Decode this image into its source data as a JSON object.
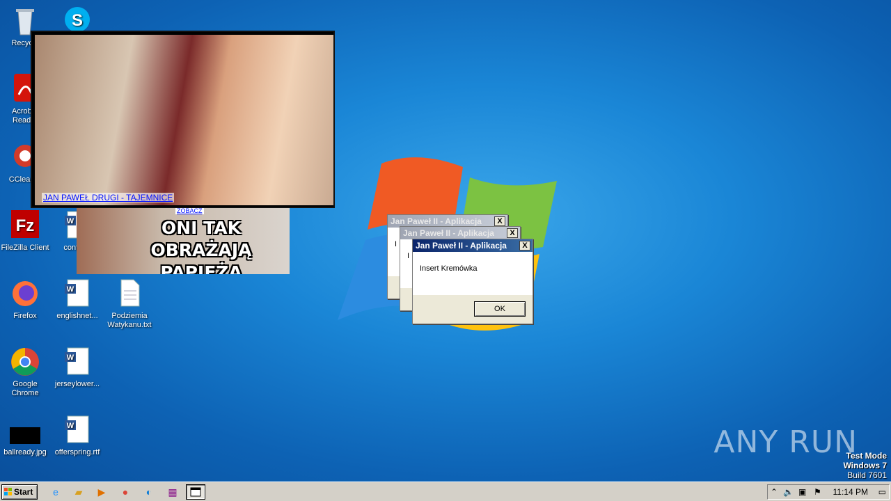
{
  "desktop_icons": [
    {
      "label": "Recycle",
      "icon": "recycle-bin-icon"
    },
    {
      "label": "",
      "icon": "skype-icon"
    },
    {
      "label": "Acrobat Reader",
      "icon": "acrobat-icon"
    },
    {
      "label": "CCleaner",
      "icon": "ccleaner-icon"
    },
    {
      "label": "FileZilla Client",
      "icon": "filezilla-icon"
    },
    {
      "label": "confer...",
      "icon": "word-doc-icon"
    },
    {
      "label": "Firefox",
      "icon": "firefox-icon"
    },
    {
      "label": "englishnet...",
      "icon": "word-doc-icon"
    },
    {
      "label": "Podziemia Watykanu.txt",
      "icon": "text-file-icon"
    },
    {
      "label": "Google Chrome",
      "icon": "chrome-icon"
    },
    {
      "label": "jerseylower...",
      "icon": "word-doc-icon"
    },
    {
      "label": "ballready.jpg",
      "icon": "image-file-icon"
    },
    {
      "label": "offerspring.rtf",
      "icon": "word-doc-icon"
    }
  ],
  "meme1": {
    "caption": "JAN PAWEŁ DRUGI - TAJEMNICE"
  },
  "meme2": {
    "text": "ONI TAK OBRAŻAJĄ PAPIEŻA",
    "tag": "ZOBACZ"
  },
  "dialogs": {
    "title": "Jan Paweł II - Aplikacja",
    "message": "Insert Kremówka",
    "ok_label": "OK",
    "close_label": "X",
    "partial_letter": "I"
  },
  "watermark": "ANY RUN",
  "test_mode": {
    "line1": "Test Mode",
    "line2": "Windows 7",
    "line3": "Build 7601"
  },
  "taskbar": {
    "start_label": "Start",
    "clock": "11:14 PM",
    "quick_launch": [
      "ie-icon",
      "explorer-icon",
      "media-player-icon",
      "chrome-icon",
      "edge-icon",
      "winrar-icon"
    ],
    "task_button": "app-window-icon"
  }
}
